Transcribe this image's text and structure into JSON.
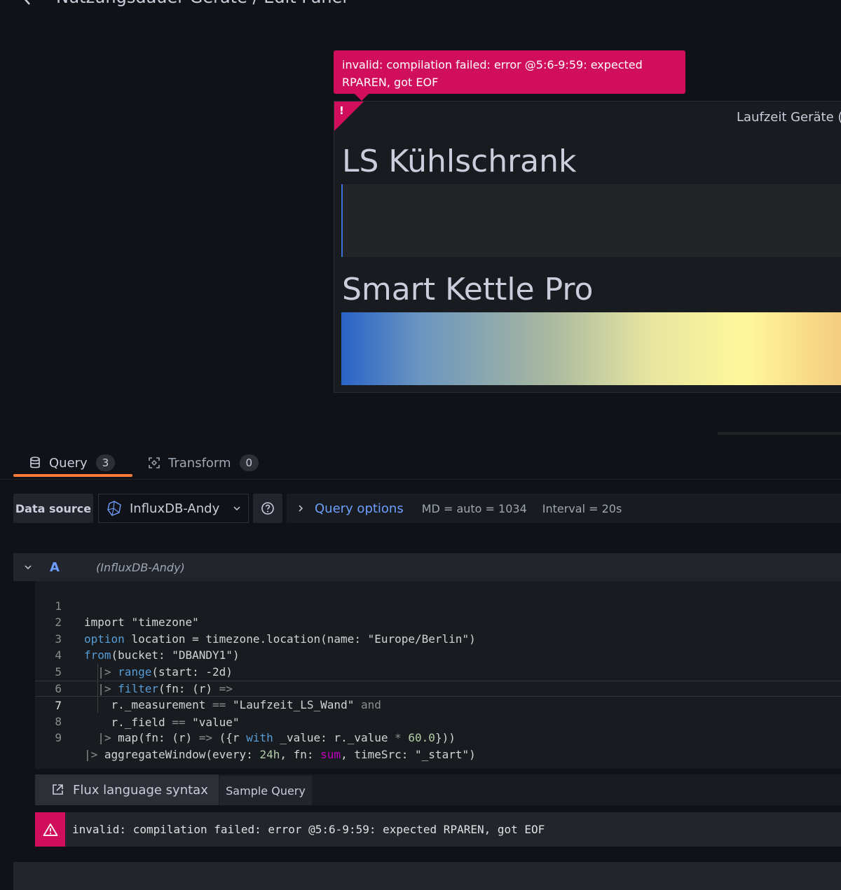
{
  "header": {
    "title": "Nutzungsdauer Geräte / Edit Panel"
  },
  "tooltip": {
    "text": "invalid: compilation failed: error @5:6-9:59: expected RPAREN, got EOF"
  },
  "panel": {
    "title": "Laufzeit Geräte (",
    "corner_mark": "!",
    "gauges": [
      {
        "label": "LS Kühlschrank"
      },
      {
        "label": "Smart Kettle Pro"
      }
    ]
  },
  "tabs": [
    {
      "label": "Query",
      "count": "3"
    },
    {
      "label": "Transform",
      "count": "0"
    }
  ],
  "datasource": {
    "label": "Data source",
    "selected": "InfluxDB-Andy"
  },
  "query_options": {
    "title": "Query options",
    "md": "MD = auto = 1034",
    "interval": "Interval = 20s"
  },
  "query_row": {
    "ref_id": "A",
    "datasource": "(InfluxDB-Andy)"
  },
  "code": {
    "lines": [
      {
        "n": "1",
        "text": "import \"timezone\""
      },
      {
        "n": "2",
        "text": "option location = timezone.location(name: \"Europe/Berlin\")"
      },
      {
        "n": "3",
        "text": "from(bucket: \"DBANDY1\")"
      },
      {
        "n": "4",
        "text": "  |> range(start: -2d)"
      },
      {
        "n": "5",
        "text": "  |> filter(fn: (r) =>"
      },
      {
        "n": "6",
        "text": "    r._measurement == \"Laufzeit_LS_Wand\" and"
      },
      {
        "n": "7",
        "text": "    r._field == \"value\""
      },
      {
        "n": "8",
        "text": "  |> map(fn: (r) => ({r with _value: r._value * 60.0}))"
      },
      {
        "n": "9",
        "text": "|> aggregateWindow(every: 24h, fn: sum, timeSrc: \"_start\")"
      }
    ]
  },
  "buttons": {
    "flux_syntax": "Flux language syntax",
    "sample_query": "Sample Query"
  },
  "error": {
    "text": "invalid: compilation failed: error @5:6-9:59: expected RPAREN, got EOF"
  },
  "colors": {
    "error": "#d10e5c",
    "accent": "#6e9fff",
    "tab_underline": "#ff7a37"
  }
}
